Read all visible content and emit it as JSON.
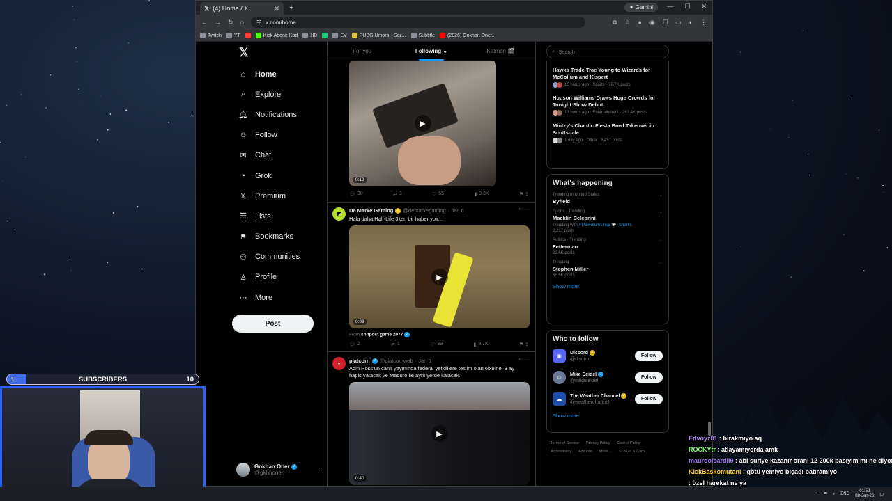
{
  "browser": {
    "tab_title": "(4) Home / X",
    "gemini_label": "Gemini",
    "url": "x.com/home",
    "bookmarks": [
      {
        "label": "Twitch",
        "color": "#8a8f98"
      },
      {
        "label": "YT",
        "color": "#8a8f98"
      },
      {
        "label": "",
        "color": "#ff3b3b"
      },
      {
        "label": "Kick Abone Kod",
        "color": "#53fc18"
      },
      {
        "label": "HD",
        "color": "#8a8f98"
      },
      {
        "label": "",
        "color": "#24c77a"
      },
      {
        "label": "EV",
        "color": "#8a8f98"
      },
      {
        "label": "PUBG Umora - Sez...",
        "color": "#e0c34a"
      },
      {
        "label": "Subtitle",
        "color": "#8a8f98"
      },
      {
        "label": "(2826) Gokhan Oner...",
        "color": "#ff0000"
      }
    ]
  },
  "x_nav": {
    "items": [
      {
        "label": "Home",
        "icon": "home-icon",
        "glyph": "⌂"
      },
      {
        "label": "Explore",
        "icon": "search-icon",
        "glyph": "⌕"
      },
      {
        "label": "Notifications",
        "icon": "bell-icon",
        "glyph": "🔔︎"
      },
      {
        "label": "Follow",
        "icon": "add-person-icon",
        "glyph": "☺"
      },
      {
        "label": "Chat",
        "icon": "mail-icon",
        "glyph": "✉"
      },
      {
        "label": "Grok",
        "icon": "grok-icon",
        "glyph": "◔"
      },
      {
        "label": "Premium",
        "icon": "x-premium-icon",
        "glyph": "𝕏"
      },
      {
        "label": "Lists",
        "icon": "list-icon",
        "glyph": "☰"
      },
      {
        "label": "Bookmarks",
        "icon": "bookmark-icon",
        "glyph": "⚑"
      },
      {
        "label": "Communities",
        "icon": "communities-icon",
        "glyph": "⚇"
      },
      {
        "label": "Profile",
        "icon": "person-icon",
        "glyph": "♙"
      },
      {
        "label": "More",
        "icon": "more-circle-icon",
        "glyph": "⋯"
      }
    ],
    "post_label": "Post",
    "account": {
      "name": "Gokhan Oner",
      "handle": "@gkhnoner"
    }
  },
  "timeline": {
    "tabs": [
      "For you",
      "Following",
      "Katman 🎬"
    ],
    "tweets": [
      {
        "duration": "0:19",
        "replies": "30",
        "reposts": "3",
        "likes": "55",
        "views": "9.3K"
      },
      {
        "name": "De Marke Gaming",
        "handle": "@demarkegaming",
        "date": "· Jan 6",
        "text": "Hala daha Half-Life 3'ten bir haber yok...",
        "duration": "0:09",
        "from_prefix": "From",
        "from_name": "shitpost game 2077",
        "replies": "2",
        "reposts": "1",
        "likes": "39",
        "views": "8.7K"
      },
      {
        "name": "platcorn",
        "handle": "@platcornweb",
        "date": "· Jan 6",
        "text": "Adin Ross'un canlı yayınında federal yetkililere teslim olan 6ix9ine, 3 ay hapis yatacak ve Maduro ile aynı yerde kalacak.",
        "duration": "0:40"
      }
    ]
  },
  "sidebar": {
    "search_placeholder": "Search",
    "news": [
      {
        "title": "Hawks Trade Trae Young to Wizards for McCollum and Kispert",
        "meta": "15 hours ago · Sports · 76.7K posts"
      },
      {
        "title": "Hudson Williams Draws Huge Crowds for Tonight Show Debut",
        "meta": "13 hours ago · Entertainment · 263.4K posts"
      },
      {
        "title": "Mintzy's Chaotic Fiesta Bowl Takeover in Scottsdale",
        "meta": "1 day ago · Other · 6,451 posts"
      }
    ],
    "happening_title": "What's happening",
    "trends": [
      {
        "context": "Trending in United States",
        "name": "Byfield",
        "sub": "",
        "link": ""
      },
      {
        "context": "Sports · Trending",
        "name": "Macklin Celebrini",
        "sub": "Trending with",
        "link": "#TheFuturesTeal 🦈, Sharks",
        "count": "2,217 posts"
      },
      {
        "context": "Politics · Trending",
        "name": "Fetterman",
        "sub": "21.5K posts",
        "link": ""
      },
      {
        "context": "Trending",
        "name": "Stephen Miller",
        "sub": "65.5K posts",
        "link": ""
      }
    ],
    "show_more": "Show more",
    "wtf_title": "Who to follow",
    "wtf": [
      {
        "name": "Discord",
        "handle": "@discord",
        "color": "#5865f2"
      },
      {
        "name": "Mike Seidel",
        "handle": "@mikeseidel",
        "color": "#6b7a99"
      },
      {
        "name": "The Weather Channel",
        "handle": "@weatherchannel",
        "color": "#1e4fa8"
      }
    ],
    "follow_label": "Follow",
    "footer": [
      "Terms of Service",
      "Privacy Policy",
      "Cookie Policy",
      "Accessibility",
      "Ads info",
      "More ...",
      "© 2026 X Corp."
    ]
  },
  "stream": {
    "subs": {
      "label": "SUBSCRIBERS",
      "current": "1",
      "goal": "10",
      "progress": 0.1
    },
    "chat": [
      {
        "user": "Edvoyz01",
        "text": ": bırakmıyo aq"
      },
      {
        "user": "ROCKYtr",
        "text": ": atlayamıyorda amk"
      },
      {
        "user": "mauroolcardii9",
        "text": ": abi suriye kazanır oranı 12 200k basıyım mı ne diyon"
      },
      {
        "user": "KickBaskomutani",
        "text": ": götü yemiyo bıçağı batıramıyo"
      },
      {
        "user": "",
        "text": ": özel harekat ne ya"
      }
    ]
  },
  "taskbar": {
    "lang": "ENG",
    "time": "01:52",
    "date": "08-Jan-26"
  }
}
